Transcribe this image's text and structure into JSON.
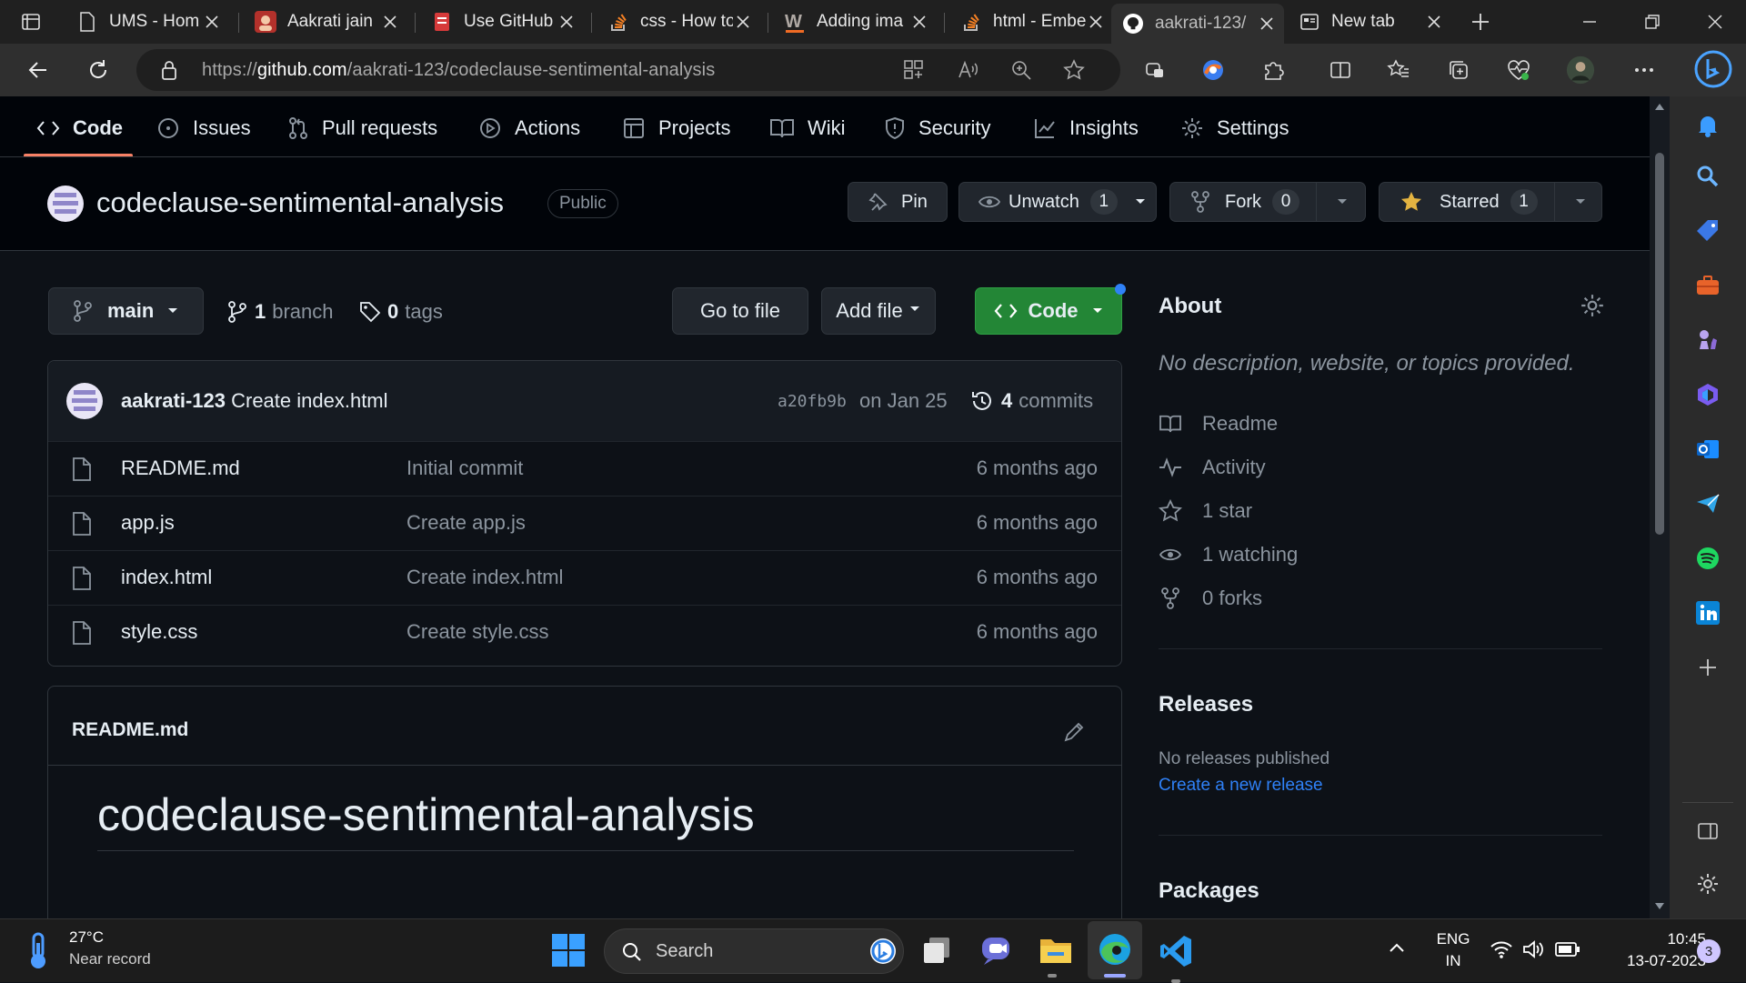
{
  "tabs": [
    {
      "title": "UMS - Hom",
      "icon": "page-icon"
    },
    {
      "title": "Aakrati jain",
      "icon": "avatar-icon"
    },
    {
      "title": "Use GitHub",
      "icon": "document-icon"
    },
    {
      "title": "css - How to",
      "icon": "stackoverflow-icon"
    },
    {
      "title": "Adding ima",
      "icon": "w3schools-icon"
    },
    {
      "title": "html - Embe",
      "icon": "stackoverflow-icon"
    },
    {
      "title": "aakrati-123/",
      "icon": "github-icon"
    },
    {
      "title": "New tab",
      "icon": "newtab-icon"
    }
  ],
  "address": {
    "scheme": "https://",
    "host": "github.com",
    "path": "/aakrati-123/codeclause-sentimental-analysis"
  },
  "repo_nav": [
    {
      "label": "Code",
      "icon": "code-icon"
    },
    {
      "label": "Issues",
      "icon": "issue-icon"
    },
    {
      "label": "Pull requests",
      "icon": "pull-request-icon"
    },
    {
      "label": "Actions",
      "icon": "play-icon"
    },
    {
      "label": "Projects",
      "icon": "table-icon"
    },
    {
      "label": "Wiki",
      "icon": "book-icon"
    },
    {
      "label": "Security",
      "icon": "shield-icon"
    },
    {
      "label": "Insights",
      "icon": "graph-icon"
    },
    {
      "label": "Settings",
      "icon": "gear-icon"
    }
  ],
  "repo": {
    "name": "codeclause-sentimental-analysis",
    "visibility": "Public",
    "pin_label": "Pin",
    "unwatch_label": "Unwatch",
    "watch_count": "1",
    "fork_label": "Fork",
    "fork_count": "0",
    "star_label": "Starred",
    "star_count": "1"
  },
  "branchbar": {
    "branch": "main",
    "branches_count": "1",
    "branches_label": "branch",
    "tags_count": "0",
    "tags_label": "tags",
    "goto_file": "Go to file",
    "add_file": "Add file",
    "code": "Code"
  },
  "commit": {
    "author": "aakrati-123",
    "message": "Create index.html",
    "sha": "a20fb9b",
    "date": "on Jan 25",
    "count": "4",
    "count_label": "commits"
  },
  "files": [
    {
      "name": "README.md",
      "message": "Initial commit",
      "age": "6 months ago"
    },
    {
      "name": "app.js",
      "message": "Create app.js",
      "age": "6 months ago"
    },
    {
      "name": "index.html",
      "message": "Create index.html",
      "age": "6 months ago"
    },
    {
      "name": "style.css",
      "message": "Create style.css",
      "age": "6 months ago"
    }
  ],
  "readme": {
    "filename": "README.md",
    "heading": "codeclause-sentimental-analysis"
  },
  "about": {
    "title": "About",
    "description": "No description, website, or topics provided.",
    "items": [
      {
        "label": "Readme",
        "icon": "book-icon"
      },
      {
        "label": "Activity",
        "icon": "pulse-icon"
      },
      {
        "label": "1 star",
        "icon": "star-icon"
      },
      {
        "label": "1 watching",
        "icon": "eye-icon"
      },
      {
        "label": "0 forks",
        "icon": "fork-icon"
      }
    ]
  },
  "releases": {
    "title": "Releases",
    "none": "No releases published",
    "create": "Create a new release"
  },
  "packages": {
    "title": "Packages"
  },
  "taskbar": {
    "weather_temp": "27°C",
    "weather_desc": "Near record",
    "search": "Search",
    "lang": "ENG",
    "region": "IN",
    "time": "10:45",
    "date": "13-07-2023",
    "notif_count": "3"
  },
  "colors": {
    "accent_green": "#238636",
    "link_blue": "#2f81f7",
    "nav_underline": "#f78166",
    "bg": "#0d1117"
  }
}
